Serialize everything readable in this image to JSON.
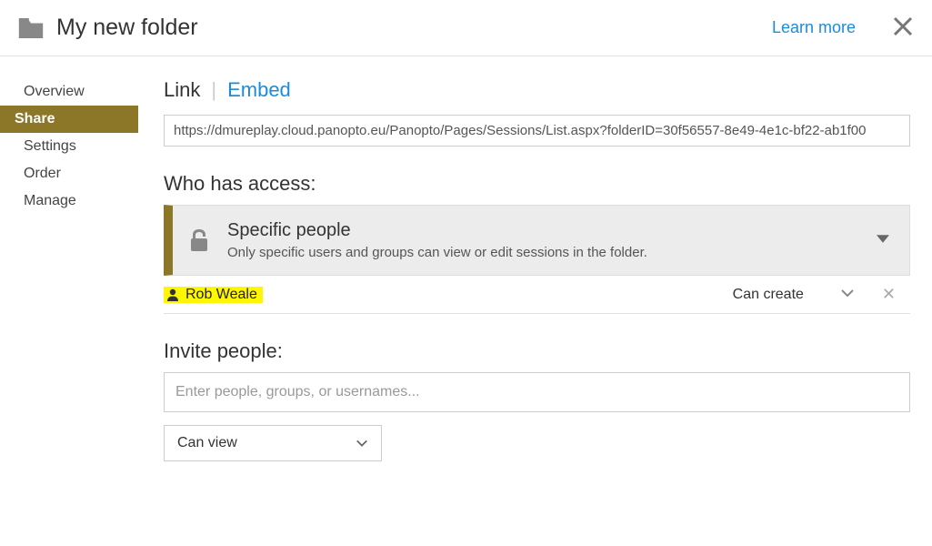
{
  "header": {
    "title": "My new folder",
    "learn_more": "Learn more"
  },
  "sidebar": {
    "items": [
      {
        "label": "Overview"
      },
      {
        "label": "Share"
      },
      {
        "label": "Settings"
      },
      {
        "label": "Order"
      },
      {
        "label": "Manage"
      }
    ],
    "active_index": 1
  },
  "tabs": {
    "link": "Link",
    "embed": "Embed"
  },
  "url_value": "https://dmureplay.cloud.panopto.eu/Panopto/Pages/Sessions/List.aspx?folderID=30f56557-8e49-4e1c-bf22-ab1f00",
  "access": {
    "heading": "Who has access:",
    "title": "Specific people",
    "description": "Only specific users and groups can view or edit sessions in the folder."
  },
  "users": [
    {
      "name": "Rob Weale",
      "permission": "Can create"
    }
  ],
  "invite": {
    "heading": "Invite people:",
    "placeholder": "Enter people, groups, or usernames...",
    "default_permission": "Can view"
  }
}
